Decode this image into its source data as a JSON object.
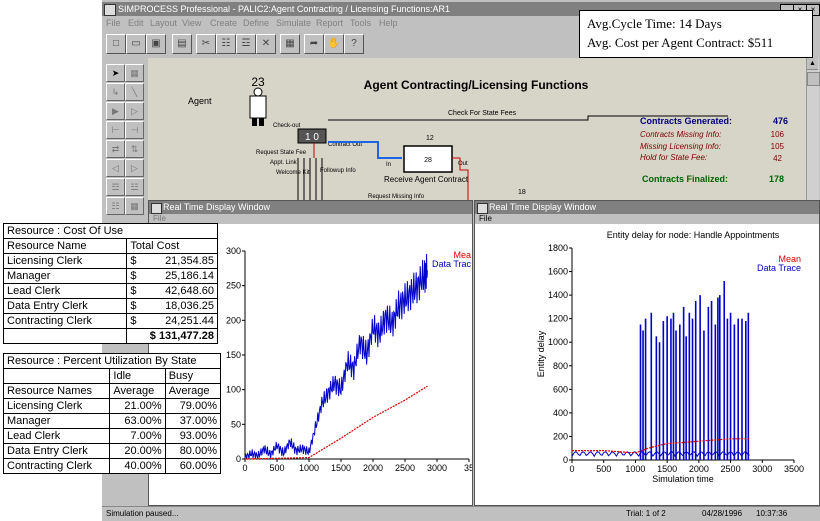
{
  "window": {
    "title": "SIMPROCESS Professional - PALIC2:Agent Contracting / Licensing Functions:AR1",
    "controls": [
      "_",
      "×",
      "×"
    ]
  },
  "menu": [
    "File",
    "Edit",
    "Layout",
    "View",
    "Create",
    "Define",
    "Simulate",
    "Report",
    "Tools",
    "Help"
  ],
  "toolbar_icons": [
    "new-icon",
    "open-icon",
    "save-icon",
    "print-icon",
    "cut-icon",
    "copy-icon",
    "paste-icon",
    "delete-icon",
    "properties-icon",
    "run-icon",
    "stop-hand-icon",
    "help-icon"
  ],
  "stats": {
    "cycle_time": "Avg.Cycle Time: 14 Days",
    "cost": "Avg. Cost per Agent Contract: $511"
  },
  "model": {
    "title": "Agent Contracting/Licensing Functions",
    "agent_count": "23",
    "agent_label": "Agent",
    "check_state_fees": "Check For State Fees",
    "check_out": "Check-out",
    "contract_out": "Contract Out",
    "box1": "1 0",
    "request_state_fee": "Request State Fee",
    "appt_link": "Appt. Link",
    "welcome_kit": "Welcome Kit",
    "followup_info": "Followup Info",
    "in_label": "In",
    "out_label": "Out",
    "count_12": "12",
    "count_28": "28",
    "count_18": "18",
    "receive_agent_contract": "Receive Agent Contract",
    "request_missing_info": "Request Missing Info",
    "contracts_generated_label": "Contracts Generated:",
    "contracts_generated_value": "476",
    "contracts_missing_label": "Contracts Missing Info:",
    "contracts_missing_value": "106",
    "missing_licensing_label": "Missing Licensing Info:",
    "missing_licensing_value": "105",
    "hold_state_fee_label": "Hold for State Fee:",
    "hold_state_fee_value": "42",
    "contracts_finalized_label": "Contracts Finalized:",
    "contracts_finalized_value": "178"
  },
  "status_bar": {
    "message": "Simulation paused...",
    "trial": "Trial: 1 of 2",
    "date": "04/28/1996",
    "time": "10:37:36"
  },
  "rt_window_1": {
    "title": "Real Time Display Window",
    "menu": "File"
  },
  "rt_window_2": {
    "title": "Real Time Display Window",
    "menu": "File"
  },
  "cost_table": {
    "title": "Resource : Cost Of Use",
    "headers": [
      "Resource Name",
      "Total Cost"
    ],
    "rows": [
      [
        "Licensing Clerk",
        "$",
        "21,354.85"
      ],
      [
        "Manager",
        "$",
        "25,186.14"
      ],
      [
        "Lead Clerk",
        "$",
        "42,648.60"
      ],
      [
        "Data Entry Clerk",
        "$",
        "18,036.25"
      ],
      [
        "Contracting Clerk",
        "$",
        "24,251.44"
      ]
    ],
    "total": "$ 131,477.28"
  },
  "util_table": {
    "title": "Resource : Percent Utilization By State",
    "group_headers": [
      "Idle",
      "Busy"
    ],
    "headers": [
      "Resource Names",
      "Average",
      "Average"
    ],
    "rows": [
      [
        "Licensing Clerk",
        "21.00%",
        "79.00%"
      ],
      [
        "Manager",
        "63.00%",
        "37.00%"
      ],
      [
        "Lead Clerk",
        "7.00%",
        "93.00%"
      ],
      [
        "Data Entry Clerk",
        "20.00%",
        "80.00%"
      ],
      [
        "Contracting Clerk",
        "40.00%",
        "60.00%"
      ]
    ]
  },
  "chart_data": [
    {
      "type": "line",
      "title": "",
      "xlabel": "",
      "ylabel": "",
      "xlim": [
        0,
        3500
      ],
      "ylim": [
        0,
        300
      ],
      "x_ticks": [
        "0",
        "500",
        "1000",
        "1500",
        "2000",
        "2500",
        "3000",
        "35"
      ],
      "y_ticks": [
        "0",
        "50",
        "100",
        "150",
        "200",
        "250",
        "300"
      ],
      "legend": [
        "Mea",
        "Data Trac"
      ],
      "colors": {
        "Data Trace": "#0000c8",
        "Mean": "#e00000"
      },
      "series": [
        {
          "name": "Data Trac",
          "x": [
            0,
            100,
            200,
            300,
            400,
            500,
            600,
            700,
            800,
            900,
            1000,
            1100,
            1200,
            1300,
            1400,
            1500,
            1600,
            1700,
            1800,
            1900,
            2000,
            2100,
            2200,
            2300,
            2400,
            2500,
            2600,
            2700,
            2800,
            2850
          ],
          "y": [
            2,
            8,
            4,
            15,
            6,
            20,
            8,
            25,
            12,
            15,
            10,
            45,
            80,
            95,
            110,
            100,
            140,
            130,
            170,
            150,
            190,
            180,
            205,
            195,
            220,
            230,
            240,
            250,
            265,
            272
          ]
        },
        {
          "name": "Mea",
          "x": [
            0,
            500,
            1000,
            1500,
            2000,
            2500,
            2850
          ],
          "y": [
            0,
            1,
            2,
            30,
            60,
            85,
            105
          ]
        }
      ]
    },
    {
      "type": "bar",
      "title": "Entity delay for node: Handle Appointments",
      "xlabel": "Simulation time",
      "ylabel": "Entity delay",
      "xlim": [
        0,
        3500
      ],
      "ylim": [
        0,
        1800
      ],
      "x_ticks": [
        "0",
        "500",
        "1000",
        "1500",
        "2000",
        "2500",
        "3000",
        "3500"
      ],
      "y_ticks": [
        "0",
        "200",
        "400",
        "600",
        "800",
        "1000",
        "1200",
        "1400",
        "1600",
        "1800"
      ],
      "legend": [
        "Mean",
        "Data Trace"
      ],
      "colors": {
        "Data Trace": "#0000c8",
        "Mean": "#e00000"
      },
      "series": [
        {
          "name": "Data Trace",
          "x": [
            1080,
            1120,
            1160,
            1250,
            1330,
            1380,
            1440,
            1500,
            1560,
            1600,
            1640,
            1700,
            1760,
            1800,
            1850,
            1900,
            1950,
            2020,
            2080,
            2150,
            2200,
            2260,
            2300,
            2330,
            2400,
            2450,
            2500,
            2560,
            2620,
            2680,
            2740,
            2780
          ],
          "y": [
            1150,
            1100,
            1200,
            1250,
            1050,
            1000,
            1180,
            1220,
            1200,
            1250,
            1100,
            1150,
            1300,
            1050,
            1250,
            1200,
            1350,
            1400,
            1100,
            1300,
            1350,
            1150,
            1380,
            1400,
            1520,
            1200,
            1250,
            1150,
            1200,
            1200,
            1180,
            1250
          ]
        },
        {
          "name": "Mean",
          "x": [
            0,
            500,
            1000,
            1200,
            1500,
            1800,
            2000,
            2500,
            2800
          ],
          "y": [
            80,
            80,
            60,
            100,
            140,
            150,
            160,
            180,
            180
          ]
        }
      ]
    }
  ]
}
